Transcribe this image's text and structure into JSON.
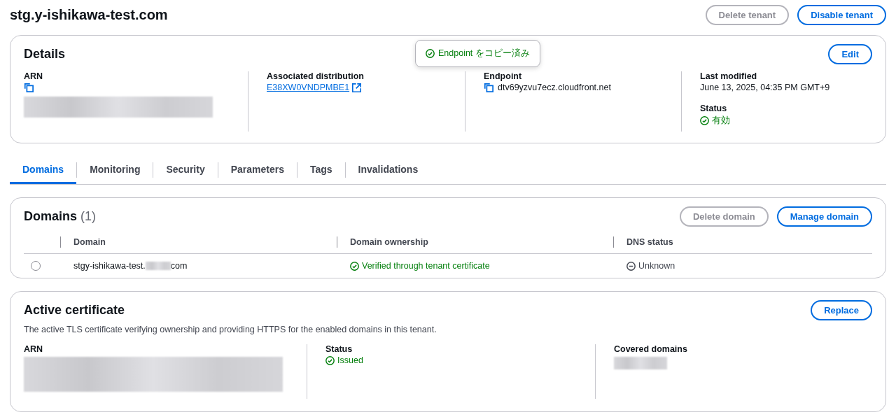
{
  "header": {
    "title": "stg.y-ishikawa-test.com",
    "buttons": [
      {
        "label": "Delete tenant",
        "disabled": true
      },
      {
        "label": "Disable tenant",
        "disabled": false
      }
    ]
  },
  "details": {
    "title": "Details",
    "edit": "Edit",
    "tooltip": "Endpoint をコピー済み",
    "arn": {
      "label": "ARN"
    },
    "distribution": {
      "label": "Associated distribution",
      "link": "E38XW0VNDPMBE1"
    },
    "endpoint": {
      "label": "Endpoint",
      "value": "dtv69yzvu7ecz.cloudfront.net"
    },
    "last_modified": {
      "label": "Last modified",
      "value": "June 13, 2025, 04:35 PM GMT+9"
    },
    "status": {
      "label": "Status",
      "value": "有効",
      "kind": "success"
    }
  },
  "tabs": [
    {
      "label": "Domains",
      "selected": true
    },
    {
      "label": "Monitoring",
      "selected": false
    },
    {
      "label": "Security",
      "selected": false
    },
    {
      "label": "Parameters",
      "selected": false
    },
    {
      "label": "Tags",
      "selected": false
    },
    {
      "label": "Invalidations",
      "selected": false
    }
  ],
  "domains": {
    "title": "Domains",
    "count": "(1)",
    "buttons": [
      {
        "label": "Delete domain",
        "disabled": true
      },
      {
        "label": "Manage domain",
        "disabled": false
      }
    ],
    "columns": [
      "Domain",
      "Domain ownership",
      "DNS status"
    ],
    "rows": [
      {
        "selected": false,
        "domain_start": "stgy-ishikawa-test.",
        "domain_end": "com",
        "ownership": {
          "text": "Verified through tenant certificate",
          "kind": "success"
        },
        "dns": {
          "text": "Unknown",
          "kind": "unknown"
        }
      }
    ]
  },
  "certificate": {
    "title": "Active certificate",
    "replace": "Replace",
    "description": "The active TLS certificate verifying ownership and providing HTTPS for the enabled domains in this tenant.",
    "arn": {
      "label": "ARN"
    },
    "status": {
      "label": "Status",
      "value": "Issued",
      "kind": "success"
    },
    "covered": {
      "label": "Covered domains"
    }
  }
}
